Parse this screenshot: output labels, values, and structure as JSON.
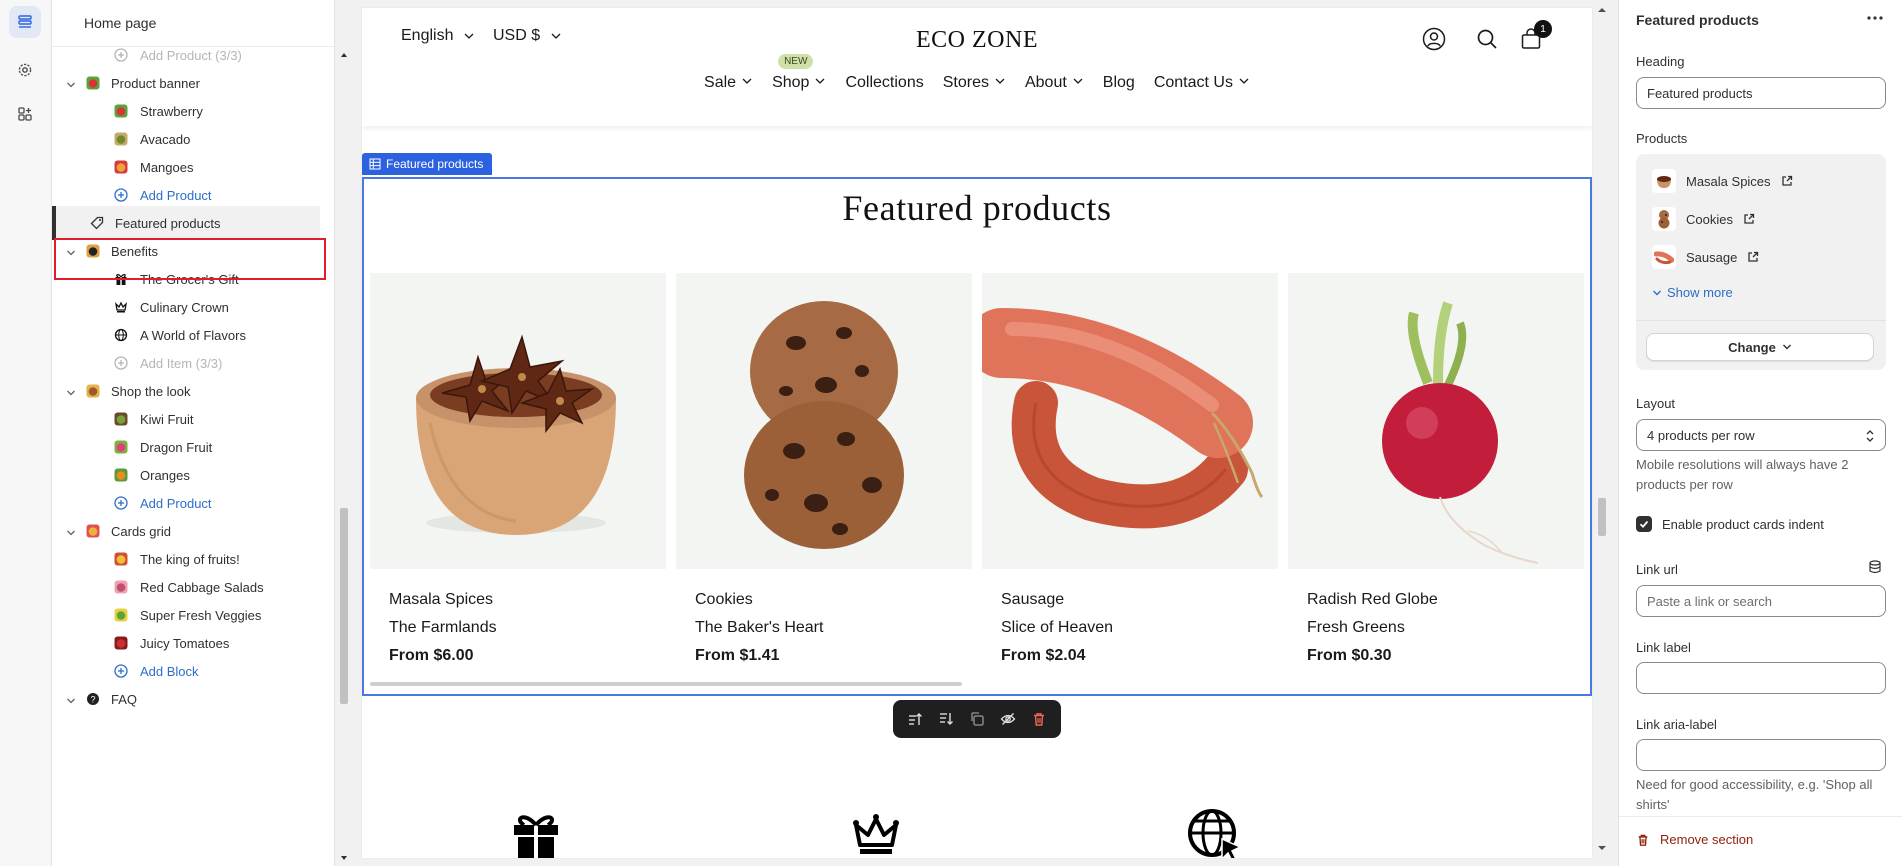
{
  "sidebar": {
    "title": "Home page",
    "rows": [
      {
        "label": "Add Product (3/3)",
        "level": 2,
        "kind": "disabled",
        "icon": "plus-circle-icon"
      },
      {
        "label": "Product banner",
        "level": 1,
        "kind": "section",
        "icon": "strawberry-icon"
      },
      {
        "label": "Strawberry",
        "level": 2,
        "kind": "block",
        "icon": "strawberry-icon"
      },
      {
        "label": "Avacado",
        "level": 2,
        "kind": "block",
        "icon": "avocado-icon"
      },
      {
        "label": "Mangoes",
        "level": 2,
        "kind": "block",
        "icon": "mango-icon"
      },
      {
        "label": "Add Product",
        "level": 2,
        "kind": "add",
        "icon": "plus-circle-icon"
      },
      {
        "label": "Featured products",
        "level": 1,
        "kind": "selected",
        "icon": "tag-icon"
      },
      {
        "label": "Benefits",
        "level": 1,
        "kind": "section",
        "icon": "benefits-icon"
      },
      {
        "label": "The Grocer's Gift",
        "level": 2,
        "kind": "block",
        "icon": "gift-icon"
      },
      {
        "label": "Culinary Crown",
        "level": 2,
        "kind": "block",
        "icon": "crown-icon"
      },
      {
        "label": "A World of Flavors",
        "level": 2,
        "kind": "block",
        "icon": "globe-icon"
      },
      {
        "label": "Add Item (3/3)",
        "level": 2,
        "kind": "disabled",
        "icon": "plus-circle-icon"
      },
      {
        "label": "Shop the look",
        "level": 1,
        "kind": "section",
        "icon": "shop-look-icon"
      },
      {
        "label": "Kiwi Fruit",
        "level": 2,
        "kind": "block",
        "icon": "kiwi-icon"
      },
      {
        "label": "Dragon Fruit",
        "level": 2,
        "kind": "block",
        "icon": "dragon-fruit-icon"
      },
      {
        "label": "Oranges",
        "level": 2,
        "kind": "block",
        "icon": "orange-icon"
      },
      {
        "label": "Add Product",
        "level": 2,
        "kind": "add",
        "icon": "plus-circle-icon"
      },
      {
        "label": "Cards grid",
        "level": 1,
        "kind": "section",
        "icon": "cards-grid-icon"
      },
      {
        "label": "The king of fruits!",
        "level": 2,
        "kind": "block",
        "icon": "fruit-card-icon"
      },
      {
        "label": "Red Cabbage Salads",
        "level": 2,
        "kind": "block",
        "icon": "cabbage-icon"
      },
      {
        "label": "Super Fresh Veggies",
        "level": 2,
        "kind": "block",
        "icon": "veggies-icon"
      },
      {
        "label": "Juicy Tomatoes",
        "level": 2,
        "kind": "block",
        "icon": "tomato-icon"
      },
      {
        "label": "Add Block",
        "level": 2,
        "kind": "add",
        "icon": "plus-circle-icon"
      },
      {
        "label": "FAQ",
        "level": 1,
        "kind": "section",
        "icon": "faq-icon"
      }
    ]
  },
  "store": {
    "language": "English",
    "currency": "USD $",
    "brand": "ECO ZONE",
    "cart_count": "1",
    "new_badge": "NEW",
    "nav": [
      {
        "label": "Sale",
        "dropdown": true
      },
      {
        "label": "Shop",
        "dropdown": true
      },
      {
        "label": "Collections",
        "dropdown": false
      },
      {
        "label": "Stores",
        "dropdown": true
      },
      {
        "label": "About",
        "dropdown": true
      },
      {
        "label": "Blog",
        "dropdown": false
      },
      {
        "label": "Contact Us",
        "dropdown": true
      }
    ],
    "section_tag": "Featured products",
    "section_title": "Featured products",
    "products": [
      {
        "name": "Masala Spices",
        "vendor": "The Farmlands",
        "price": "From $6.00",
        "image": "star-anise-bowl"
      },
      {
        "name": "Cookies",
        "vendor": "The Baker's Heart",
        "price": "From $1.41",
        "image": "cookies"
      },
      {
        "name": "Sausage",
        "vendor": "Slice of Heaven",
        "price": "From $2.04",
        "image": "sausage"
      },
      {
        "name": "Radish Red Globe",
        "vendor": "Fresh Greens",
        "price": "From $0.30",
        "image": "radish"
      }
    ],
    "benefit_icons": [
      "gift-icon",
      "crown-icon",
      "globe-icon"
    ]
  },
  "toolbar": {
    "tools": [
      "move-up-icon",
      "move-down-icon",
      "duplicate-icon",
      "hide-icon",
      "delete-icon"
    ]
  },
  "panel": {
    "title": "Featured products",
    "heading_label": "Heading",
    "heading_value": "Featured products",
    "products_label": "Products",
    "products": [
      "Masala Spices",
      "Cookies",
      "Sausage"
    ],
    "show_more": "Show more",
    "change": "Change",
    "layout_label": "Layout",
    "layout_value": "4 products per row",
    "layout_help": "Mobile resolutions will always have 2 products per row",
    "indent_label": "Enable product cards indent",
    "indent_checked": true,
    "link_url_label": "Link url",
    "link_url_placeholder": "Paste a link or search",
    "link_label_label": "Link label",
    "link_aria_label": "Link aria-label",
    "link_aria_help": "Need for good accessibility, e.g. 'Shop all shirts'",
    "remove": "Remove section"
  },
  "colors": {
    "accent": "#2c62e0",
    "selection_outline": "#e11d2a",
    "link": "#2c6ecb",
    "danger": "#8e1f0b"
  }
}
